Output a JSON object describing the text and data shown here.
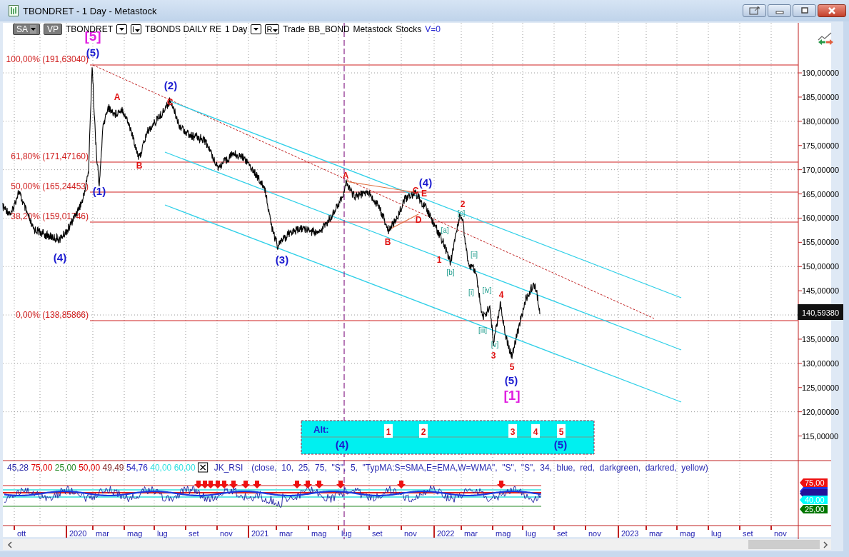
{
  "window": {
    "title": "TBONDRET - 1 Day - Metastock"
  },
  "toolbar": [
    {
      "kind": "chip",
      "text": "SA",
      "caret": true
    },
    {
      "kind": "chip",
      "text": "VP",
      "caret": false
    },
    {
      "kind": "text",
      "text": "TBONDRET"
    },
    {
      "kind": "caret"
    },
    {
      "kind": "boxed",
      "text": "I"
    },
    {
      "kind": "text",
      "text": "TBONDS DAILY RE"
    },
    {
      "kind": "text",
      "text": "1 Day"
    },
    {
      "kind": "caret"
    },
    {
      "kind": "boxed",
      "text": "R"
    },
    {
      "kind": "text",
      "text": "Trade"
    },
    {
      "kind": "text",
      "text": "BB_BOND"
    },
    {
      "kind": "text",
      "text": "Metastock"
    },
    {
      "kind": "text",
      "text": "Stocks"
    },
    {
      "kind": "value",
      "text": "V=0"
    }
  ],
  "price_chart": {
    "y_axis": [
      "190,00000",
      "185,00000",
      "180,00000",
      "175,00000",
      "170,00000",
      "165,00000",
      "160,00000",
      "155,00000",
      "150,00000",
      "145,00000",
      "135,00000",
      "130,00000",
      "125,00000",
      "120,00000",
      "115,00000"
    ],
    "last_price": "140,59380",
    "fib_levels": [
      "100,00% (191,63040)",
      "61,80% (171,47160)",
      "50,00% (165,24453)",
      "38,20% (159,01746)",
      "0,00% (138,85866)"
    ],
    "wave_labels": [
      {
        "text": "[5]",
        "kind": "primary"
      },
      {
        "text": "(5)",
        "kind": "intermediate"
      },
      {
        "text": "A",
        "kind": "minor"
      },
      {
        "text": "(2)",
        "kind": "intermediate"
      },
      {
        "text": "C",
        "kind": "minor"
      },
      {
        "text": "B",
        "kind": "minor"
      },
      {
        "text": "(1)",
        "kind": "intermediate"
      },
      {
        "text": "(4)",
        "kind": "intermediate"
      },
      {
        "text": "(3)",
        "kind": "intermediate"
      },
      {
        "text": "A",
        "kind": "minor"
      },
      {
        "text": "(4)",
        "kind": "intermediate"
      },
      {
        "text": "C",
        "kind": "minor"
      },
      {
        "text": "E",
        "kind": "minor"
      },
      {
        "text": "D",
        "kind": "minor"
      },
      {
        "text": "B",
        "kind": "minor"
      },
      {
        "text": "2",
        "kind": "minor"
      },
      {
        "text": "[c]",
        "kind": "minute"
      },
      {
        "text": "[a]",
        "kind": "minute"
      },
      {
        "text": "1",
        "kind": "minor"
      },
      {
        "text": "[ii]",
        "kind": "minute"
      },
      {
        "text": "[b]",
        "kind": "minute"
      },
      {
        "text": "[i]",
        "kind": "minute"
      },
      {
        "text": "[iv]",
        "kind": "minute"
      },
      {
        "text": "4",
        "kind": "minor"
      },
      {
        "text": "[iii]",
        "kind": "minute"
      },
      {
        "text": "[v]",
        "kind": "minute"
      },
      {
        "text": "3",
        "kind": "minor"
      },
      {
        "text": "5",
        "kind": "minor"
      },
      {
        "text": "(5)",
        "kind": "intermediate"
      },
      {
        "text": "[1]",
        "kind": "primary"
      }
    ],
    "alt_box": {
      "label": "Alt:",
      "marks": [
        "1",
        "2",
        "3",
        "4",
        "5"
      ],
      "waves": [
        "(4)",
        "(5)"
      ]
    }
  },
  "rsi_panel": {
    "values": [
      {
        "text": "45,28",
        "color": "#2a2aa8"
      },
      {
        "text": "75,00",
        "color": "#dd0000"
      },
      {
        "text": "25,00",
        "color": "#228822"
      },
      {
        "text": "50,00",
        "color": "#dd0000"
      },
      {
        "text": "49,49",
        "color": "#802828"
      },
      {
        "text": "54,76",
        "color": "#2a2ac0"
      },
      {
        "text": "40,00",
        "color": "#30e0e0"
      },
      {
        "text": "60,00",
        "color": "#30e0e0"
      }
    ],
    "name": "JK_RSI",
    "params": "(close,  10,  25,  75,  \"S\",  5,  \"TypMA:S=SMA,E=EMA,W=WMA\",  \"S\",  \"S\",  34,  blue,  red,  darkgreen,  darkred,  yellow)",
    "tags": [
      {
        "text": "75,00",
        "color": "#ee1111"
      },
      {
        "color": "#2233dd"
      },
      {
        "color": "#221199"
      },
      {
        "text": "40,00",
        "color": "#00ffff"
      },
      {
        "text": "25,00",
        "color": "#007700"
      }
    ]
  },
  "x_axis": [
    {
      "text": "ott",
      "year": false
    },
    {
      "text": "2020",
      "year": true
    },
    {
      "text": "mar",
      "year": false
    },
    {
      "text": "mag",
      "year": false
    },
    {
      "text": "lug",
      "year": false
    },
    {
      "text": "set",
      "year": false
    },
    {
      "text": "nov",
      "year": false
    },
    {
      "text": "2021",
      "year": true
    },
    {
      "text": "mar",
      "year": false
    },
    {
      "text": "mag",
      "year": false
    },
    {
      "text": "lug",
      "year": false
    },
    {
      "text": "set",
      "year": false
    },
    {
      "text": "nov",
      "year": false
    },
    {
      "text": "2022",
      "year": true
    },
    {
      "text": "mar",
      "year": false
    },
    {
      "text": "mag",
      "year": false
    },
    {
      "text": "lug",
      "year": false
    },
    {
      "text": "set",
      "year": false
    },
    {
      "text": "nov",
      "year": false
    },
    {
      "text": "2023",
      "year": true
    },
    {
      "text": "mar",
      "year": false
    },
    {
      "text": "mag",
      "year": false
    },
    {
      "text": "lug",
      "year": false
    },
    {
      "text": "set",
      "year": false
    },
    {
      "text": "nov",
      "year": false
    }
  ]
}
